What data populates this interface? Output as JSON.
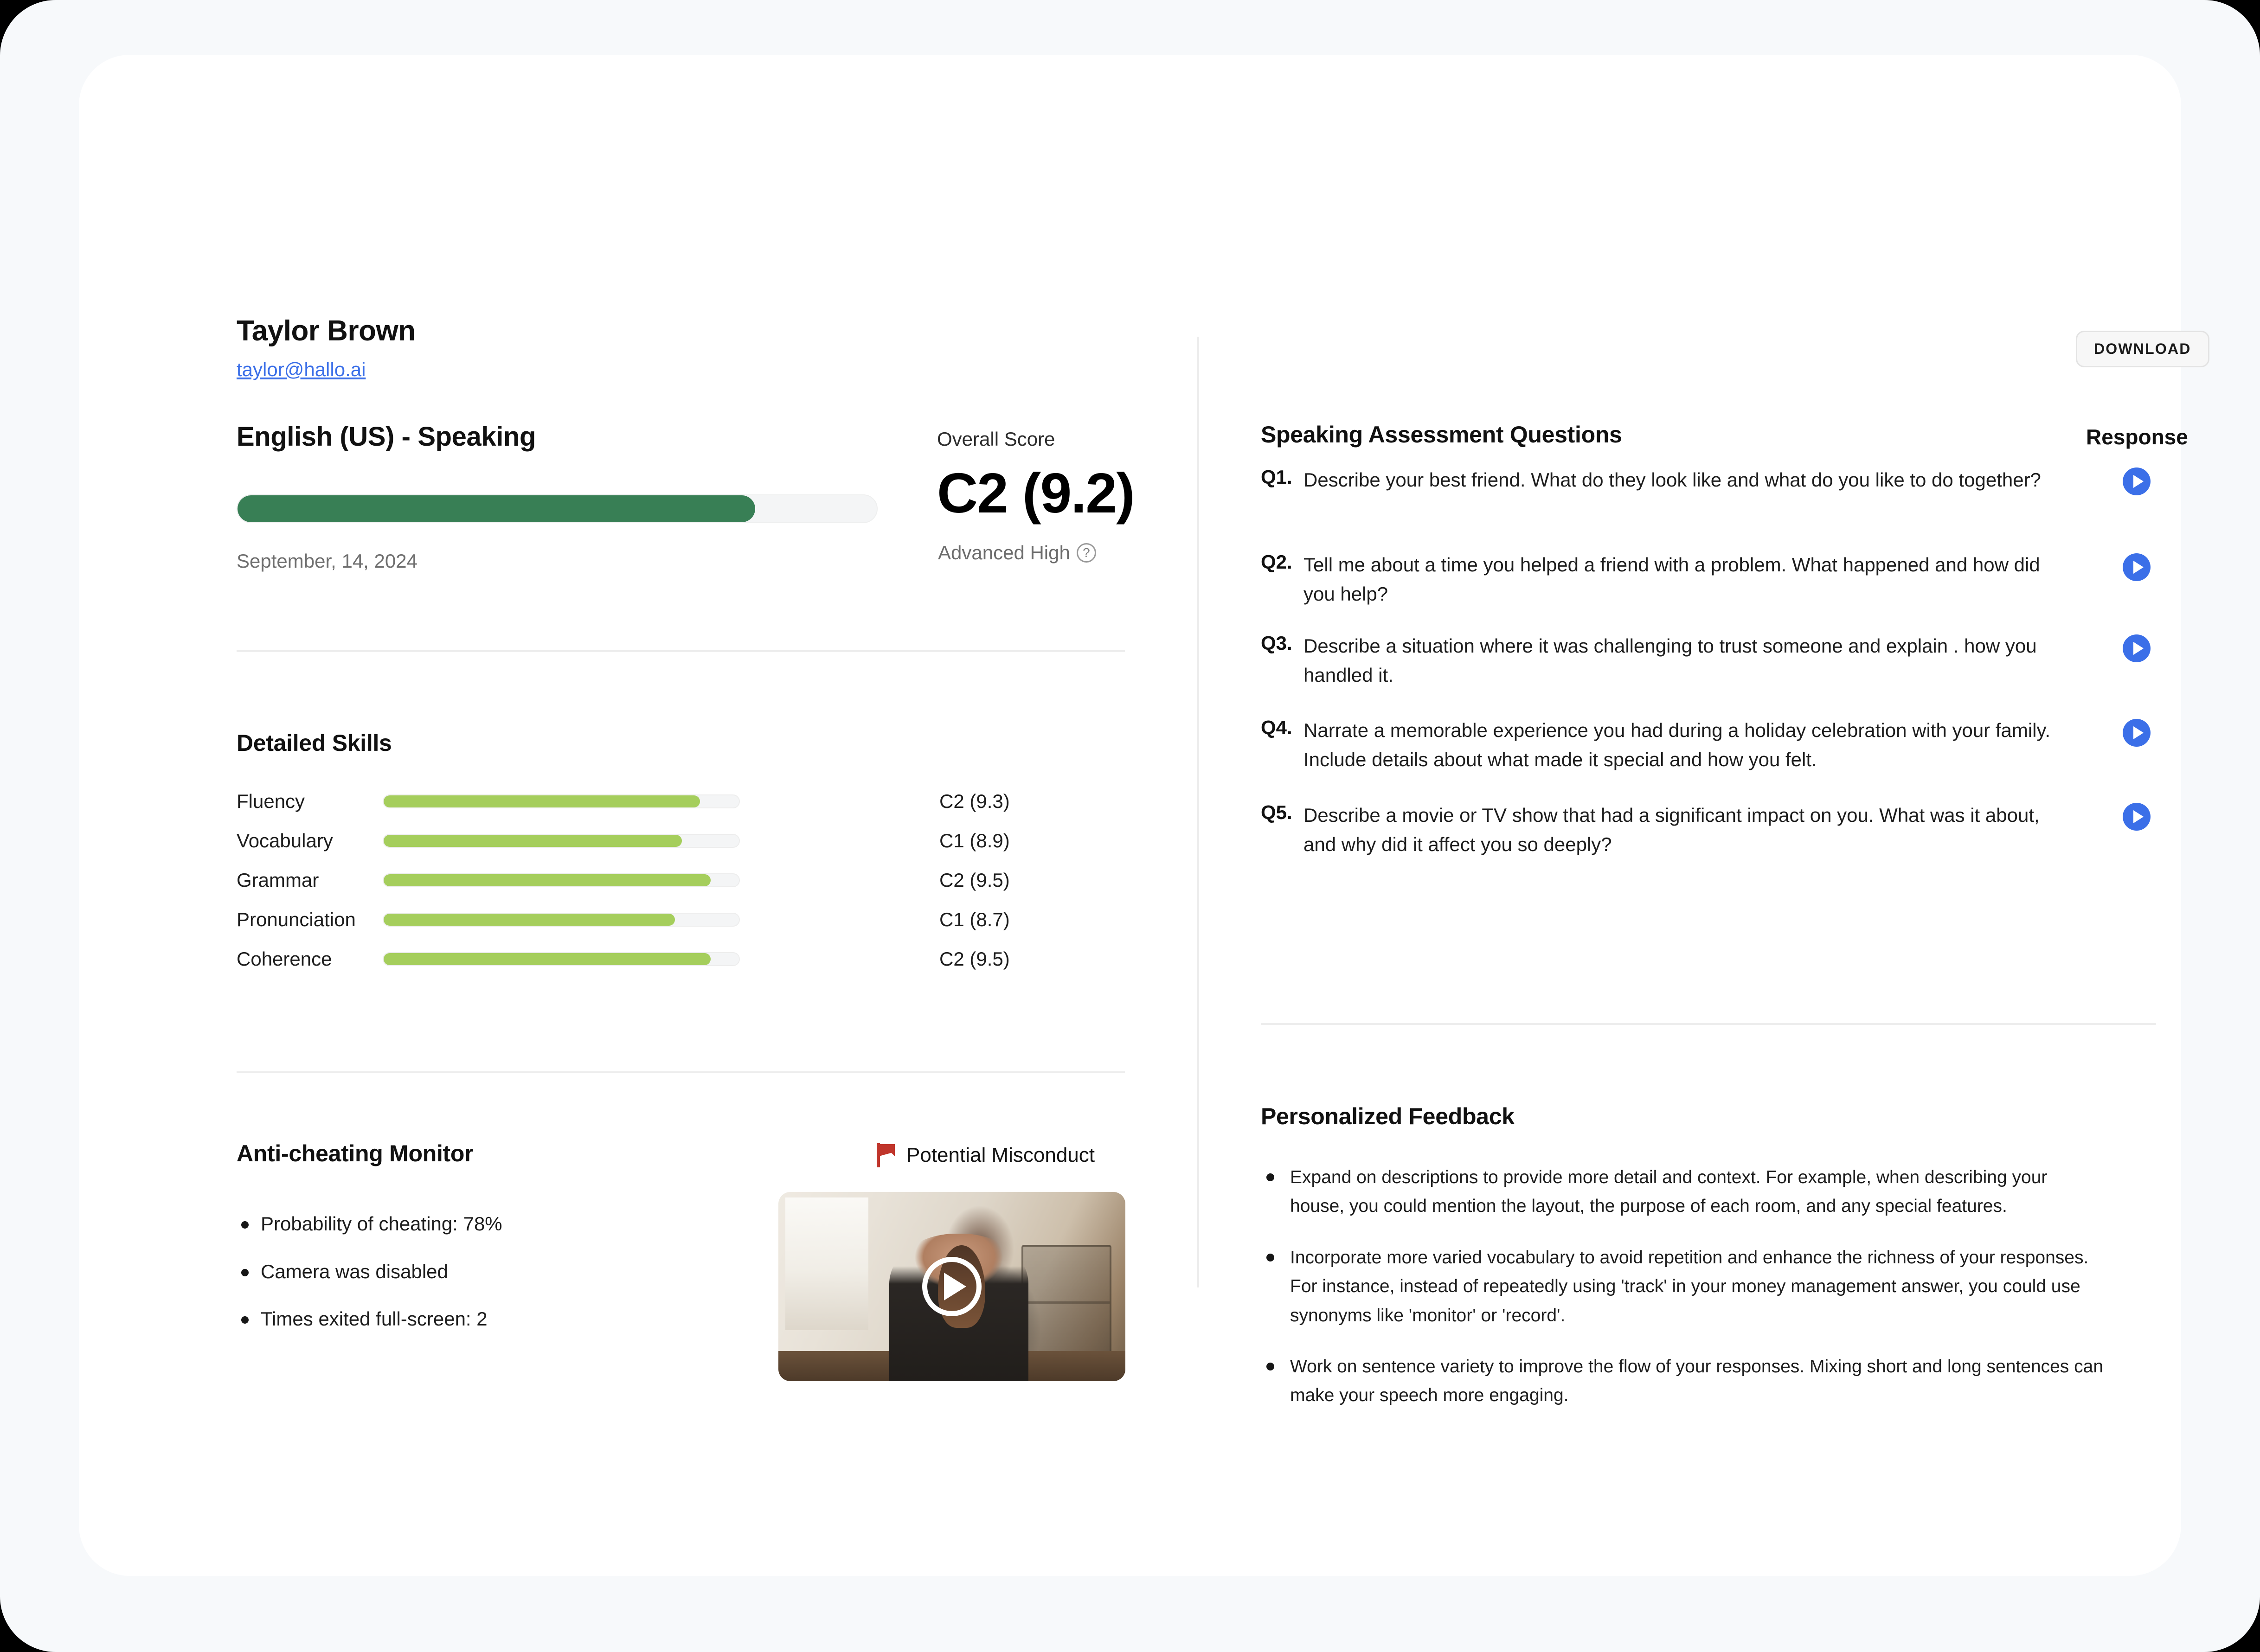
{
  "header": {
    "person_name": "Taylor Brown",
    "person_email": "taylor@hallo.ai",
    "download_label": "DOWNLOAD"
  },
  "assessment": {
    "test_title": "English (US) - Speaking",
    "overall_score_label": "Overall Score",
    "overall_score_value": "C2 (9.2)",
    "overall_level": "Advanced High",
    "help_glyph": "?",
    "date": "September, 14, 2024",
    "progress_percent": 81,
    "progress_color": "#387f55"
  },
  "detailed_skills": {
    "heading": "Detailed Skills",
    "bar_color": "#a5ce5c",
    "rows": [
      {
        "name": "Fluency",
        "score": "C2 (9.3)",
        "percent": 89
      },
      {
        "name": "Vocabulary",
        "score": "C1 (8.9)",
        "percent": 84
      },
      {
        "name": "Grammar",
        "score": "C2 (9.5)",
        "percent": 92
      },
      {
        "name": "Pronunciation",
        "score": "C1 (8.7)",
        "percent": 82
      },
      {
        "name": "Coherence",
        "score": "C2 (9.5)",
        "percent": 92
      }
    ]
  },
  "anti_cheating": {
    "heading": "Anti-cheating Monitor",
    "status_label": "Potential Misconduct",
    "status_color": "#c0352b",
    "items": [
      "Probability of cheating: 78%",
      "Camera was disabled",
      "Times exited full-screen: 2"
    ]
  },
  "questions_panel": {
    "heading": "Speaking Assessment Questions",
    "response_column_label": "Response",
    "play_button_color": "#3b6fe8",
    "items": [
      {
        "num": "Q1.",
        "text": "Describe your best friend. What do they look like and what do you like to do together?"
      },
      {
        "num": "Q2.",
        "text": "Tell me about a time you helped a friend with a problem. What happened and how did you help?"
      },
      {
        "num": "Q3.",
        "text": "Describe a situation where it was challenging to trust someone and explain  . how you handled it."
      },
      {
        "num": "Q4.",
        "text": "Narrate a memorable experience you had during a holiday celebration with your family. Include details about what made it special and how you felt."
      },
      {
        "num": "Q5.",
        "text": "Describe a movie or TV show that had a significant impact on you. What was it about, and why did it affect you so deeply?"
      }
    ]
  },
  "feedback": {
    "heading": "Personalized Feedback",
    "items": [
      "Expand on descriptions to provide more detail and context. For example, when describing your house, you could mention the layout, the purpose of each room, and any special features.",
      "Incorporate more varied vocabulary to avoid repetition and enhance the richness of your responses. For instance, instead of repeatedly using 'track' in your money management answer, you could use synonyms like 'monitor' or 'record'.",
      "Work on sentence variety to improve the flow of your responses. Mixing short and long sentences can make your speech more engaging."
    ]
  }
}
